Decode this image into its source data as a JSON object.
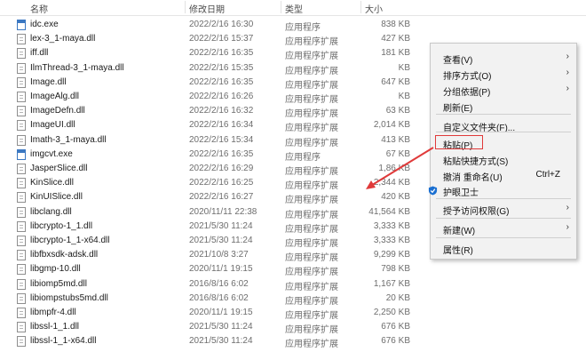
{
  "header": {
    "name": "名称",
    "date": "修改日期",
    "type": "类型",
    "size": "大小"
  },
  "files": [
    {
      "name": "idc.exe",
      "date": "2022/2/16 16:30",
      "type": "应用程序",
      "size": "838 KB",
      "icon": "exe-icon"
    },
    {
      "name": "lex-3_1-maya.dll",
      "date": "2022/2/16 15:37",
      "type": "应用程序扩展",
      "size": "427 KB",
      "icon": "dll-icon"
    },
    {
      "name": "iff.dll",
      "date": "2022/2/16 16:35",
      "type": "应用程序扩展",
      "size": "181 KB",
      "icon": "dll-icon"
    },
    {
      "name": "IlmThread-3_1-maya.dll",
      "date": "2022/2/16 15:35",
      "type": "应用程序扩展",
      "size": "KB",
      "icon": "dll-icon"
    },
    {
      "name": "Image.dll",
      "date": "2022/2/16 16:35",
      "type": "应用程序扩展",
      "size": "647 KB",
      "icon": "dll-icon"
    },
    {
      "name": "ImageAlg.dll",
      "date": "2022/2/16 16:26",
      "type": "应用程序扩展",
      "size": "KB",
      "icon": "dll-icon"
    },
    {
      "name": "ImageDefn.dll",
      "date": "2022/2/16 16:32",
      "type": "应用程序扩展",
      "size": "63 KB",
      "icon": "dll-icon"
    },
    {
      "name": "ImageUI.dll",
      "date": "2022/2/16 16:34",
      "type": "应用程序扩展",
      "size": "2,014 KB",
      "icon": "dll-icon"
    },
    {
      "name": "Imath-3_1-maya.dll",
      "date": "2022/2/16 15:34",
      "type": "应用程序扩展",
      "size": "413 KB",
      "icon": "dll-icon"
    },
    {
      "name": "imgcvt.exe",
      "date": "2022/2/16 16:35",
      "type": "应用程序",
      "size": "67 KB",
      "icon": "exe-icon"
    },
    {
      "name": "JasperSlice.dll",
      "date": "2022/2/16 16:29",
      "type": "应用程序扩展",
      "size": "1,86 KB",
      "icon": "dll-icon"
    },
    {
      "name": "KinSlice.dll",
      "date": "2022/2/16 16:25",
      "type": "应用程序扩展",
      "size": "2,344 KB",
      "icon": "dll-icon"
    },
    {
      "name": "KinUISlice.dll",
      "date": "2022/2/16 16:27",
      "type": "应用程序扩展",
      "size": "420 KB",
      "icon": "dll-icon"
    },
    {
      "name": "libclang.dll",
      "date": "2020/11/11 22:38",
      "type": "应用程序扩展",
      "size": "41,564 KB",
      "icon": "dll-icon"
    },
    {
      "name": "libcrypto-1_1.dll",
      "date": "2021/5/30 11:24",
      "type": "应用程序扩展",
      "size": "3,333 KB",
      "icon": "dll-icon"
    },
    {
      "name": "libcrypto-1_1-x64.dll",
      "date": "2021/5/30 11:24",
      "type": "应用程序扩展",
      "size": "3,333 KB",
      "icon": "dll-icon"
    },
    {
      "name": "libfbxsdk-adsk.dll",
      "date": "2021/10/8 3:27",
      "type": "应用程序扩展",
      "size": "9,299 KB",
      "icon": "dll-icon"
    },
    {
      "name": "libgmp-10.dll",
      "date": "2020/11/1 19:15",
      "type": "应用程序扩展",
      "size": "798 KB",
      "icon": "dll-icon"
    },
    {
      "name": "libiomp5md.dll",
      "date": "2016/8/16 6:02",
      "type": "应用程序扩展",
      "size": "1,167 KB",
      "icon": "dll-icon"
    },
    {
      "name": "libiompstubs5md.dll",
      "date": "2016/8/16 6:02",
      "type": "应用程序扩展",
      "size": "20 KB",
      "icon": "dll-icon"
    },
    {
      "name": "libmpfr-4.dll",
      "date": "2020/11/1 19:15",
      "type": "应用程序扩展",
      "size": "2,250 KB",
      "icon": "dll-icon"
    },
    {
      "name": "libssl-1_1.dll",
      "date": "2021/5/30 11:24",
      "type": "应用程序扩展",
      "size": "676 KB",
      "icon": "dll-icon"
    },
    {
      "name": "libssl-1_1-x64.dll",
      "date": "2021/5/30 11:24",
      "type": "应用程序扩展",
      "size": "676 KB",
      "icon": "dll-icon"
    }
  ],
  "context_menu": {
    "items": [
      {
        "label": "查看(V)",
        "submenu": true
      },
      {
        "label": "排序方式(O)",
        "submenu": true
      },
      {
        "label": "分组依据(P)",
        "submenu": true
      },
      {
        "label": "刷新(E)"
      },
      {
        "label": "自定义文件夹(F)..."
      },
      {
        "label": "粘贴(P)",
        "highlighted": true
      },
      {
        "label": "粘贴快捷方式(S)"
      },
      {
        "label": "撤消 重命名(U)",
        "shortcut": "Ctrl+Z"
      },
      {
        "label": "护眼卫士",
        "icon": "shield-icon"
      },
      {
        "label": "授予访问权限(G)",
        "submenu": true
      },
      {
        "label": "新建(W)",
        "submenu": true
      },
      {
        "label": "属性(R)"
      }
    ],
    "submenu_arrow": "›"
  },
  "colors": {
    "highlight_box": "#e03a3a",
    "arrow": "#e03a3a",
    "menu_bg": "#f2f2f2"
  }
}
